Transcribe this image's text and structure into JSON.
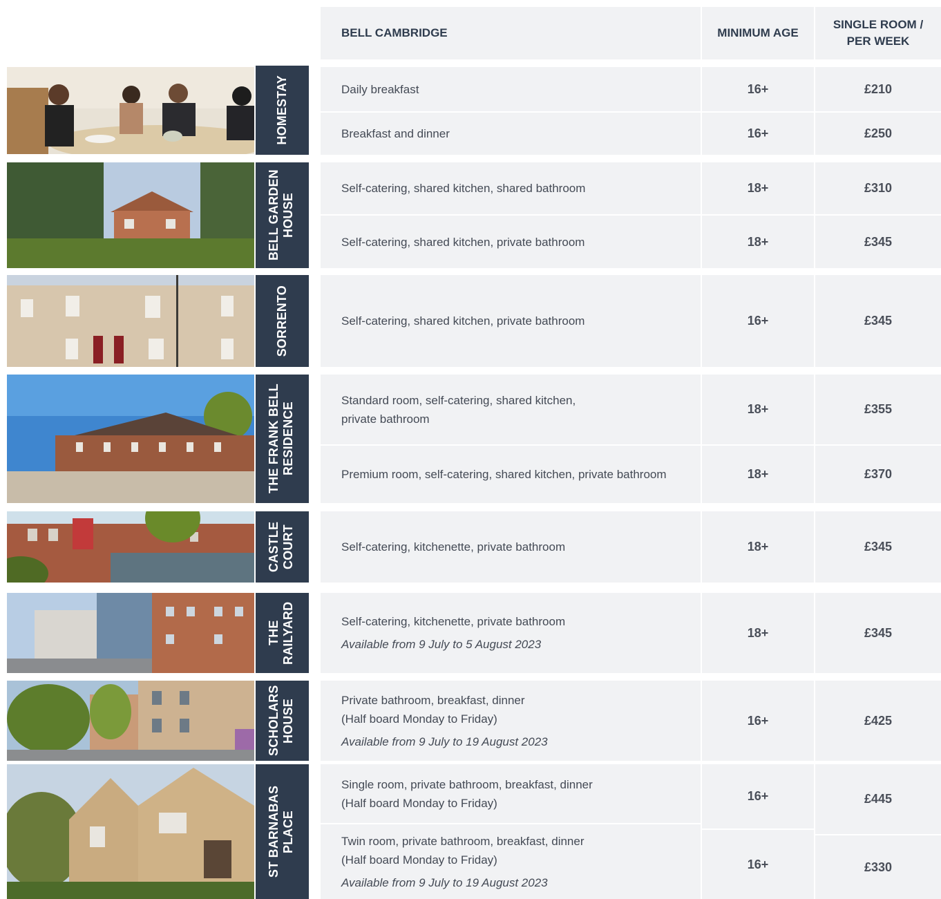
{
  "header": {
    "school": "BELL CAMBRIDGE",
    "min_age": "MINIMUM AGE",
    "price_line1": "SINGLE ROOM /",
    "price_line2": "PER WEEK"
  },
  "accommodations": [
    {
      "label": "HOMESTAY",
      "photo": "homestay-family-meal-photo",
      "options": [
        {
          "desc": "Daily breakfast",
          "age": "16+",
          "price": "£210"
        },
        {
          "desc": "Breakfast and dinner",
          "age": "16+",
          "price": "£250"
        }
      ]
    },
    {
      "label": "BELL GARDEN HOUSE",
      "photo": "bell-garden-house-photo",
      "options": [
        {
          "desc": "Self-catering, shared kitchen, shared bathroom",
          "age": "18+",
          "price": "£310"
        },
        {
          "desc": "Self-catering, shared kitchen, private bathroom",
          "age": "18+",
          "price": "£345"
        }
      ]
    },
    {
      "label": "SORRENTO",
      "photo": "sorrento-building-photo",
      "options": [
        {
          "desc": "Self-catering, shared kitchen, private bathroom",
          "age": "16+",
          "price": "£345"
        }
      ]
    },
    {
      "label": "THE FRANK BELL RESIDENCE",
      "photo": "frank-bell-residence-photo",
      "options": [
        {
          "desc": "Standard room, self-catering, shared kitchen,",
          "desc2": "private bathroom",
          "age": "18+",
          "price": "£355"
        },
        {
          "desc": "Premium room, self-catering, shared kitchen, private bathroom",
          "age": "18+",
          "price": "£370"
        }
      ]
    },
    {
      "label": "CASTLE COURT",
      "photo": "castle-court-photo",
      "options": [
        {
          "desc": "Self-catering, kitchenette, private bathroom",
          "age": "18+",
          "price": "£345"
        }
      ]
    },
    {
      "label": "THE RAILYARD",
      "photo": "the-railyard-photo",
      "options": [
        {
          "desc": "Self-catering, kitchenette, private bathroom",
          "avail": "Available from 9 July to 5 August 2023",
          "age": "18+",
          "price": "£345"
        }
      ]
    },
    {
      "label": "SCHOLARS HOUSE",
      "photo": "scholars-house-photo",
      "options": [
        {
          "desc": "Private bathroom, breakfast, dinner",
          "desc2": "(Half board Monday to Friday)",
          "avail": "Available from 9 July to 19 August 2023",
          "age": "16+",
          "price": "£425"
        }
      ]
    },
    {
      "label": "ST BARNABAS PLACE",
      "photo": "st-barnabas-place-photo",
      "options": [
        {
          "desc": "Single room, private bathroom, breakfast, dinner",
          "desc2": "(Half board Monday to Friday)",
          "age": "16+",
          "price": "£445"
        },
        {
          "desc": "Twin room, private bathroom, breakfast, dinner",
          "desc2": "(Half board Monday to Friday)",
          "avail": "Available from 9 July to 19 August 2023",
          "age": "16+",
          "price": "£330"
        }
      ]
    }
  ]
}
